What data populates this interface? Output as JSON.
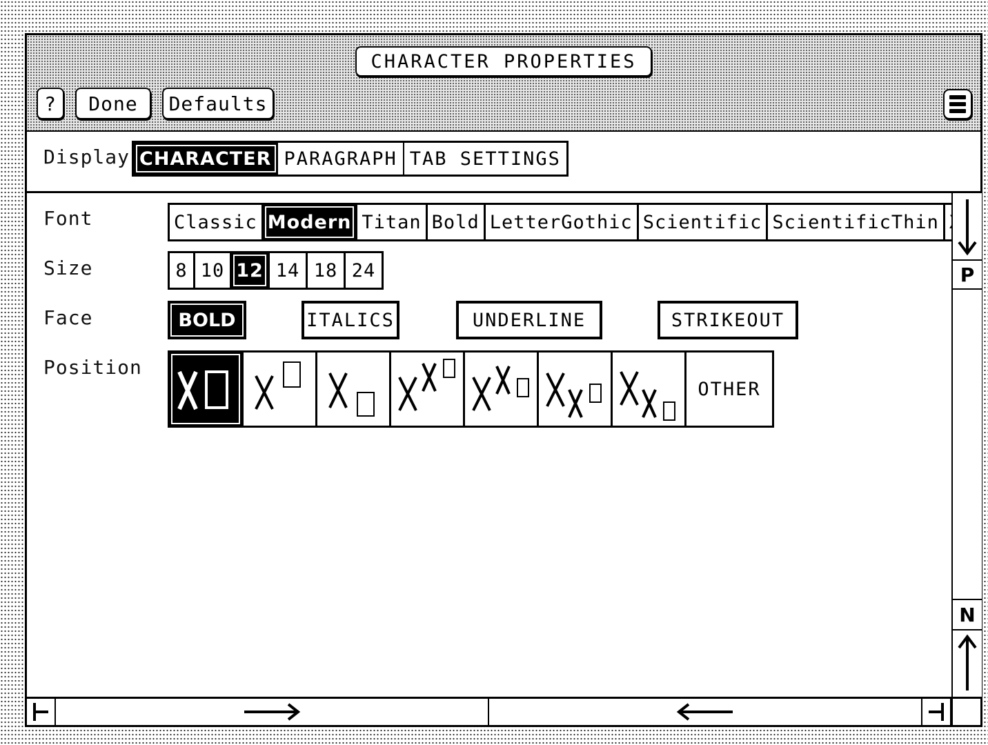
{
  "window": {
    "title": "CHARACTER PROPERTIES",
    "buttons": {
      "help_label": "?",
      "done_label": "Done",
      "defaults_label": "Defaults"
    },
    "menu_icon": "menu-icon"
  },
  "display": {
    "label": "Display",
    "tabs": [
      {
        "label": "CHARACTER",
        "selected": true
      },
      {
        "label": "PARAGRAPH",
        "selected": false
      },
      {
        "label": "TAB SETTINGS",
        "selected": false
      }
    ]
  },
  "properties": {
    "font": {
      "label": "Font",
      "options": [
        "Classic",
        "Modern",
        "Titan",
        "Bold",
        "LetterGothic",
        "Scientific",
        "ScientificThin",
        "Xer"
      ],
      "selected": "Modern"
    },
    "size": {
      "label": "Size",
      "options": [
        "8",
        "10",
        "12",
        "14",
        "18",
        "24"
      ],
      "selected": "12"
    },
    "face": {
      "label": "Face",
      "options": [
        {
          "label": "BOLD",
          "selected": true
        },
        {
          "label": "ITALICS",
          "selected": false
        },
        {
          "label": "UNDERLINE",
          "selected": false
        },
        {
          "label": "STRIKEOUT",
          "selected": false
        }
      ]
    },
    "position": {
      "label": "Position",
      "options": [
        {
          "name": "normal",
          "selected": true
        },
        {
          "name": "superscript",
          "selected": false
        },
        {
          "name": "subscript",
          "selected": false
        },
        {
          "name": "super-superscript",
          "selected": false
        },
        {
          "name": "super-subscript",
          "selected": false
        },
        {
          "name": "sub-superscript",
          "selected": false
        },
        {
          "name": "sub-subscript",
          "selected": false
        },
        {
          "name": "other",
          "label": "OTHER",
          "selected": false
        }
      ]
    }
  },
  "scrollbars": {
    "vertical": {
      "prev_label": "P",
      "next_label": "N"
    },
    "horizontal": {}
  }
}
